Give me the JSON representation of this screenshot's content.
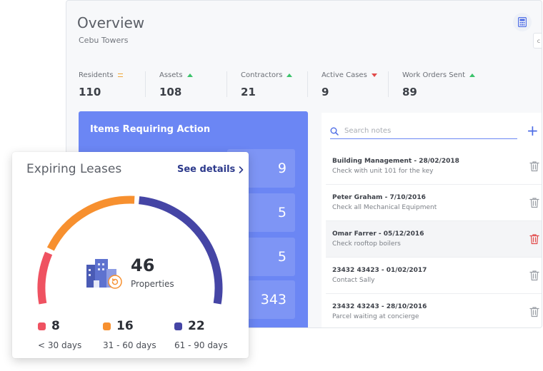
{
  "overview": {
    "title": "Overview",
    "subtitle": "Cebu Towers",
    "calculator_icon": "calculator-icon"
  },
  "stats": [
    {
      "label": "Residents",
      "value": "110",
      "trend": "flat"
    },
    {
      "label": "Assets",
      "value": "108",
      "trend": "up"
    },
    {
      "label": "Contractors",
      "value": "21",
      "trend": "up"
    },
    {
      "label": "Active Cases",
      "value": "9",
      "trend": "down"
    },
    {
      "label": "Work Orders Sent",
      "value": "89",
      "trend": "up"
    }
  ],
  "action_panel": {
    "title": "Items Requiring Action",
    "counts": [
      "9",
      "5",
      "5",
      "343"
    ]
  },
  "notes": {
    "search_placeholder": "Search notes",
    "add_label": "+",
    "items": [
      {
        "title": "Building Management - 28/02/2018",
        "detail": "Check with unit 101 for the key",
        "selected": false
      },
      {
        "title": "Peter Graham - 7/10/2016",
        "detail": "Check all Mechanical Equipment",
        "selected": false
      },
      {
        "title": "Omar Farrer - 05/12/2016",
        "detail": "Check rooftop boilers",
        "selected": true
      },
      {
        "title": "23432 43423 - 01/02/2017",
        "detail": "Contact Sally",
        "selected": false
      },
      {
        "title": "23432 43243 - 28/10/2016",
        "detail": "Parcel waiting at concierge",
        "selected": false
      }
    ]
  },
  "leases": {
    "title": "Expiring Leases",
    "see_details": "See details",
    "total": "46",
    "total_label": "Properties",
    "buckets": [
      {
        "count": "8",
        "range": "< 30 days",
        "color": "#ef5261"
      },
      {
        "count": "16",
        "range": "31 - 60 days",
        "color": "#f7902f"
      },
      {
        "count": "22",
        "range": "61 - 90 days",
        "color": "#4545a5"
      }
    ]
  },
  "colors": {
    "accent": "#6b86f4",
    "danger": "#e24a4a",
    "up": "#3cc36b",
    "flat": "#f0a63a"
  }
}
